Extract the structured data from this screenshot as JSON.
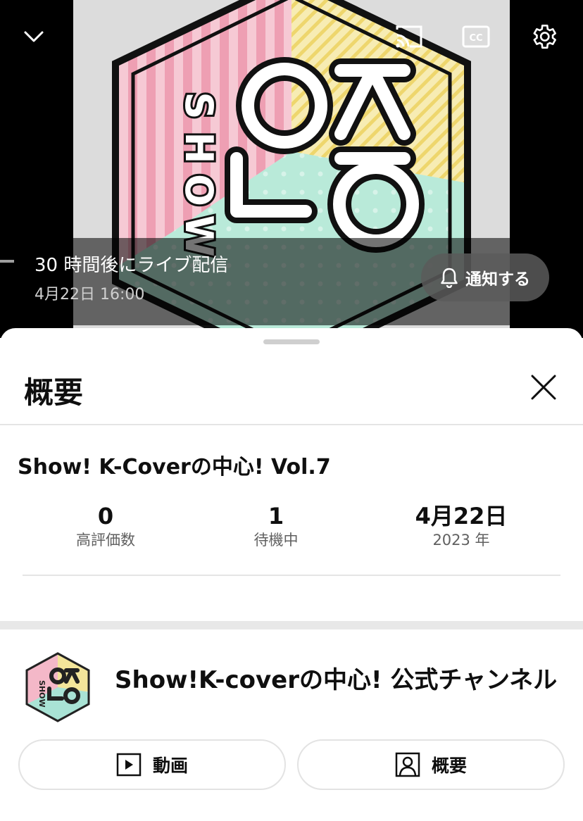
{
  "player": {
    "live_title": "30 時間後にライブ配信",
    "live_date": "4月22日 16:00",
    "notify_label": "通知する",
    "icons": [
      "chevron-down-icon",
      "cast-icon",
      "closed-captions-icon",
      "gear-icon",
      "bell-icon"
    ]
  },
  "thumbnail": {
    "logo_text": "SHOW"
  },
  "sheet": {
    "title": "概要",
    "video_title": "Show! K-Coverの中心! Vol.7",
    "stats": {
      "likes_value": "0",
      "likes_label": "高評価数",
      "waiting_value": "1",
      "waiting_label": "待機中",
      "date_value": "4月22日",
      "date_year": "2023 年"
    },
    "channel": {
      "name": "Show!K-coverの中心! 公式チャンネル",
      "avatar_text": "SHOW"
    },
    "buttons": {
      "videos": "動画",
      "about": "概要"
    }
  },
  "colors": {
    "player_bg": "#000000",
    "notify_bg": "#5a5a5a",
    "text_primary": "#0f0f0f",
    "text_secondary": "#606060",
    "divider": "#e5e5e5",
    "logo_pink": "#f4b8c8",
    "logo_yellow": "#f3e59a",
    "logo_mint": "#a9e3d5"
  }
}
